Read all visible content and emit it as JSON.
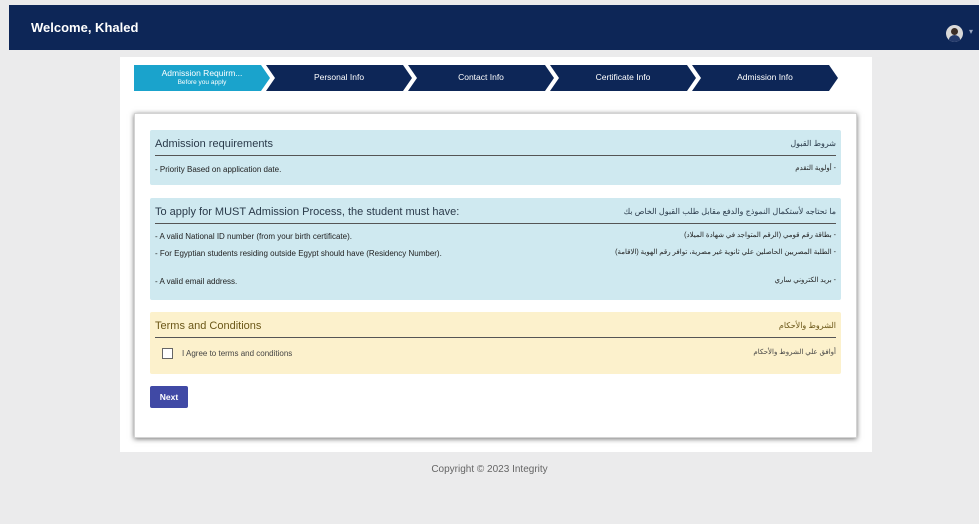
{
  "header": {
    "welcome": "Welcome, Khaled",
    "avatar_icon": "user-avatar-icon",
    "caret_icon": "chevron-down-icon"
  },
  "stepper": {
    "steps": [
      {
        "label": "Admission Requirm...",
        "sub": "Before you apply",
        "state": "active"
      },
      {
        "label": "Personal Info",
        "state": "inactive"
      },
      {
        "label": "Contact Info",
        "state": "inactive"
      },
      {
        "label": "Certificate Info",
        "state": "inactive"
      },
      {
        "label": "Admission Info",
        "state": "inactive"
      }
    ]
  },
  "requirements": {
    "title_en": "Admission requirements",
    "title_ar": "شروط القبول",
    "item_en": "- Priority Based on application date.",
    "item_ar": "- أولوية التقدم"
  },
  "must_have": {
    "title_en": "To apply for MUST Admission Process, the student must have:",
    "title_ar": "ما تحتاجه لأستكمال النموذج والدفع مقابل طلب القبول الخاص بك",
    "items": [
      {
        "en": "- A valid National ID number (from your birth certificate).",
        "ar": "- بطاقة رقم قومي (الرقم المتواجد في شهادة الميلاد)"
      },
      {
        "en": "- For Egyptian students residing outside Egypt should have (Residency Number).",
        "ar": "- الطلبة المصريين الحاصلين علي ثانوية غير مصرية، توافر رقم الهوية (الاقامة)"
      },
      {
        "en": "- A valid email address.",
        "ar": "- بريد الكتروني ساري"
      }
    ]
  },
  "terms": {
    "title_en": "Terms and Conditions",
    "title_ar": "الشروط والأحكام",
    "agree_en": "I Agree to terms and conditions",
    "agree_ar": "أوافق علي الشروط والأحكام",
    "checked": false
  },
  "actions": {
    "next_label": "Next"
  },
  "footer": {
    "copyright": "Copyright © 2023 Integrity"
  },
  "colors": {
    "navy": "#0d2657",
    "active_step": "#1aa3cc",
    "info_panel": "#cfe9f0",
    "terms_panel": "#fcf1cc",
    "button": "#4049a5"
  }
}
